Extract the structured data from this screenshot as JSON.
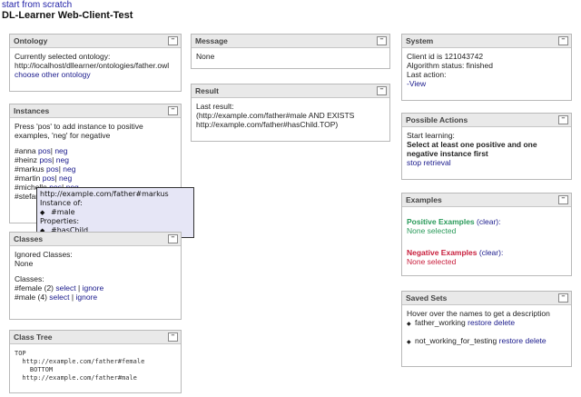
{
  "header": {
    "start_link": "start from scratch",
    "title": "DL-Learner Web-Client-Test"
  },
  "ontology": {
    "title": "Ontology",
    "line1": "Currently selected ontology:",
    "url": "http://localhost/dllearner/ontologies/father.owl",
    "choose": "choose other ontology"
  },
  "instances": {
    "title": "Instances",
    "hint1": "Press 'pos' to add instance to positive",
    "hint2": "examples, 'neg' for negative",
    "items": [
      {
        "name": "#anna",
        "pos": "pos",
        "sep": "|",
        "neg": "neg"
      },
      {
        "name": "#heinz",
        "pos": "pos",
        "sep": "|",
        "neg": "neg"
      },
      {
        "name": "#markus",
        "pos": "pos",
        "sep": "|",
        "neg": "neg"
      },
      {
        "name": "#martin",
        "pos": "pos",
        "sep": "|",
        "neg": "neg"
      },
      {
        "name": "#michelle",
        "pos": "pos",
        "sep": "|",
        "neg": "neg"
      },
      {
        "name": "#stefan",
        "pos": "pos",
        "sep": "|",
        "neg": "neg"
      }
    ]
  },
  "tooltip": {
    "url": "http://example.com/father#markus",
    "instance_of": "Instance of:",
    "class1": "#male",
    "properties": "Properties:",
    "prop1": "#hasChild"
  },
  "classes": {
    "title": "Classes",
    "ignored_label": "Ignored Classes:",
    "ignored_value": "None",
    "classes_label": "Classes:",
    "items": [
      {
        "name": "#female",
        "count": "(2)",
        "select": "select",
        "sep": "|",
        "ignore": "ignore"
      },
      {
        "name": "#male",
        "count": "(4)",
        "select": "select",
        "sep": "|",
        "ignore": "ignore"
      }
    ]
  },
  "class_tree": {
    "title": "Class Tree",
    "lines": [
      "TOP",
      "  http://example.com/father#female",
      "    BOTTOM",
      "  http://example.com/father#male"
    ]
  },
  "message": {
    "title": "Message",
    "text": "None"
  },
  "result": {
    "title": "Result",
    "label": "Last result:",
    "line1": "(http://example.com/father#male AND EXISTS",
    "line2": "http://example.com/father#hasChild.TOP)"
  },
  "system": {
    "title": "System",
    "client_id": "Client id is 121043742",
    "algo": "Algorithm status: finished",
    "last_action": "Last action:",
    "view": "-View"
  },
  "actions": {
    "title": "Possible Actions",
    "start": "Start learning:",
    "select1": "Select at least one positive and one",
    "select2": "negative instance first",
    "stop": "stop retrieval"
  },
  "examples": {
    "title": "Examples",
    "pos_title": "Positive Examples",
    "clear": "(clear):",
    "pos_none": "None selected",
    "neg_title": "Negative Examples",
    "neg_none": "None selected"
  },
  "saved": {
    "title": "Saved Sets",
    "hint": "Hover over the names to get a description",
    "items": [
      {
        "name": "father_working",
        "restore": "restore",
        "delete": "delete"
      },
      {
        "name": "not_working_for_testing",
        "restore": "restore",
        "delete": "delete"
      }
    ]
  },
  "minimize_glyph": "–"
}
